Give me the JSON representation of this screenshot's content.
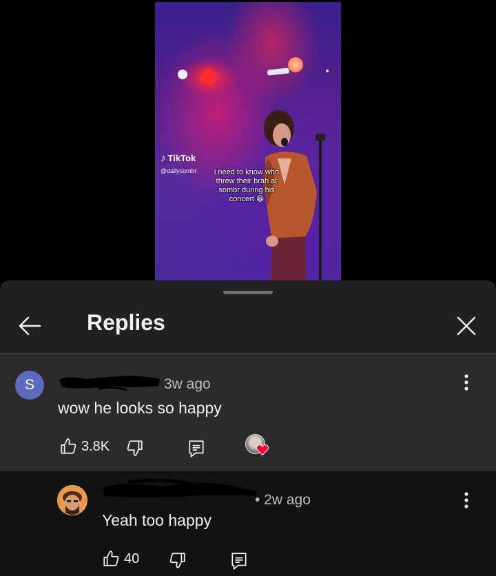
{
  "video": {
    "brand": "TikTok",
    "handle": "@dailysombr",
    "caption": "i need to know who threw their brah at sombr during his concert 😁"
  },
  "sheet": {
    "title": "Replies",
    "back_icon": "arrow-left-icon",
    "close_icon": "close-icon"
  },
  "parent_comment": {
    "avatar_letter": "S",
    "avatar_color": "#5c6bc0",
    "time": "3w ago",
    "text": "wow he looks so happy",
    "likes": "3.8K"
  },
  "reply": {
    "time": "• 2w ago",
    "text": "Yeah too happy",
    "likes": "40"
  },
  "colors": {
    "sheet_bg": "#212121",
    "parent_bg": "#2b2b2b",
    "reply_bg": "#121212",
    "heart": "#ff0033"
  }
}
